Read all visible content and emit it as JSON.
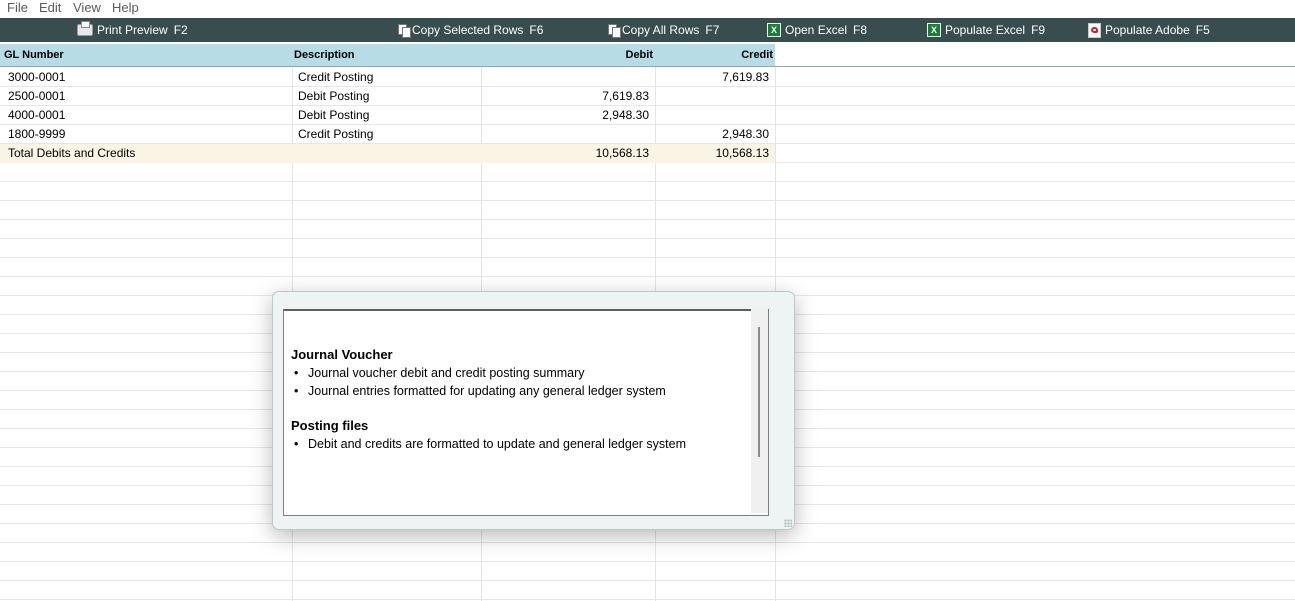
{
  "menu": [
    "File",
    "Edit",
    "View",
    "Help"
  ],
  "toolbar": {
    "print_preview": {
      "label": "Print Preview",
      "key": "F2",
      "icon": "printer-icon"
    },
    "copy_selected": {
      "label": "Copy Selected Rows",
      "key": "F6",
      "icon": "copy-icon"
    },
    "copy_all": {
      "label": "Copy All Rows",
      "key": "F7",
      "icon": "copy-icon"
    },
    "open_excel": {
      "label": "Open Excel",
      "key": "F8",
      "icon": "excel-icon"
    },
    "populate_excel": {
      "label": "Populate Excel",
      "key": "F9",
      "icon": "excel-icon"
    },
    "populate_adobe": {
      "label": "Populate Adobe",
      "key": "F5",
      "icon": "pdf-icon"
    }
  },
  "table": {
    "headers": {
      "gl": "GL Number",
      "desc": "Description",
      "debit": "Debit",
      "credit": "Credit"
    },
    "rows": [
      {
        "gl": "3000-0001",
        "desc": "Credit Posting",
        "debit": "",
        "credit": "7,619.83"
      },
      {
        "gl": "2500-0001",
        "desc": "Debit Posting",
        "debit": "7,619.83",
        "credit": ""
      },
      {
        "gl": "4000-0001",
        "desc": "Debit Posting",
        "debit": "2,948.30",
        "credit": ""
      },
      {
        "gl": "1800-9999",
        "desc": "Credit Posting",
        "debit": "",
        "credit": "2,948.30"
      }
    ],
    "total": {
      "label": "Total Debits and Credits",
      "debit": "10,568.13",
      "credit": "10,568.13"
    }
  },
  "popup": {
    "section1": {
      "title": "Journal Voucher",
      "bullets": [
        "Journal voucher debit and credit posting summary",
        "Journal entries formatted for updating any general ledger system"
      ]
    },
    "section2": {
      "title": "Posting files",
      "bullets": [
        "Debit and credits are formatted to update and general ledger system"
      ]
    }
  },
  "colors": {
    "toolbar_bg": "#384d4d",
    "header_bg": "#b8dce6",
    "total_row_bg": "#fbf3e4"
  }
}
